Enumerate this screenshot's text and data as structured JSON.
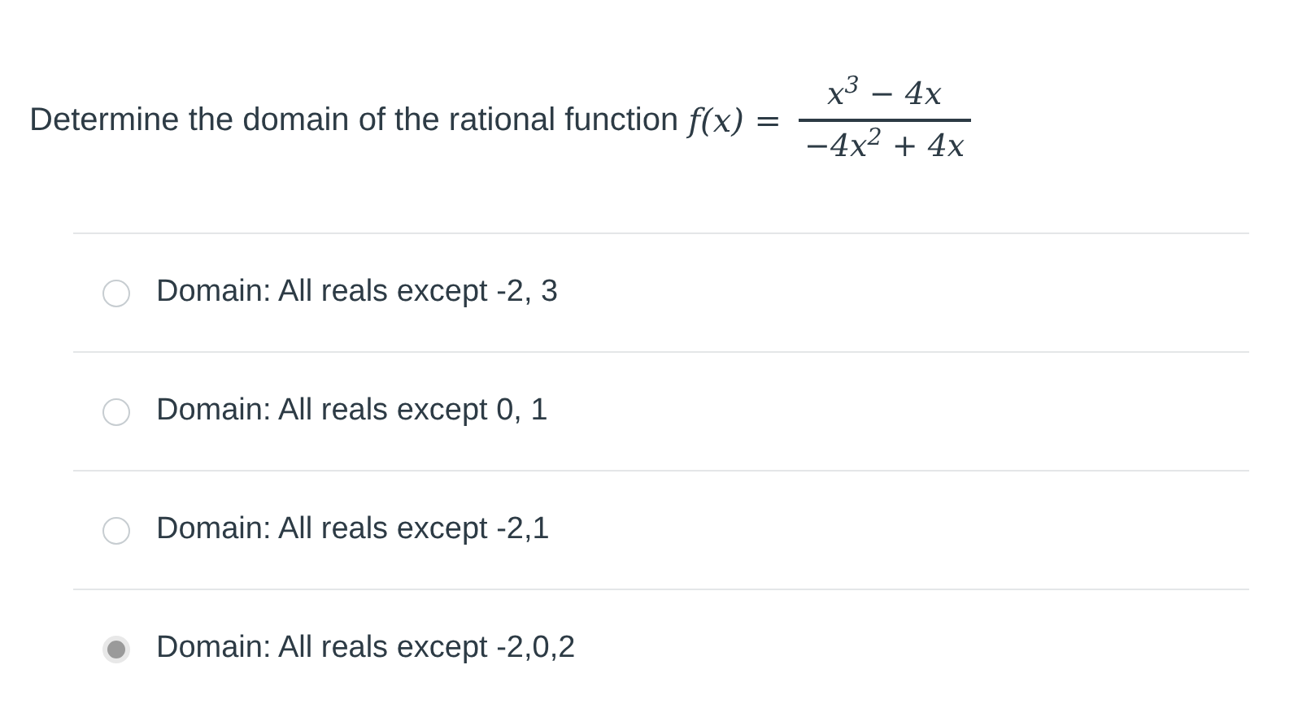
{
  "question": {
    "text": "Determine the domain of the rational function",
    "function": "f(x) =",
    "numerator": "x$^{3}$ − 4x",
    "denominator": "−4x$^{2}$ + 4x"
  },
  "options": [
    {
      "label": "Domain: All reals except -2, 3",
      "selected": false
    },
    {
      "label": "Domain: All reals except 0, 1",
      "selected": false
    },
    {
      "label": "Domain: All reals except -2,1",
      "selected": false
    },
    {
      "label": "Domain: All reals except -2,0,2",
      "selected": true
    }
  ]
}
